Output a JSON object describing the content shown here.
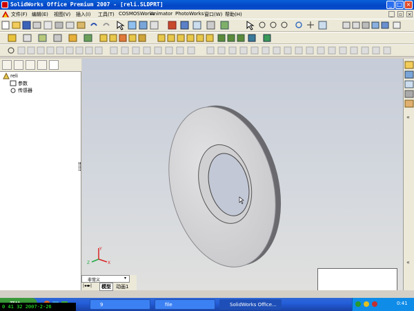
{
  "window": {
    "title": "SolidWorks Office Premium 2007 - [reli.SLDPRT]"
  },
  "menu": {
    "items": [
      "文件(F)",
      "编辑(E)",
      "视图(V)",
      "插入(I)",
      "工具(T)",
      "COSMOSWorks",
      "Animator",
      "PhotoWorks",
      "窗口(W)",
      "帮助(H)"
    ]
  },
  "tree": {
    "root": "reli",
    "items": [
      "参数",
      "传感器"
    ]
  },
  "bottom_tabs": {
    "config": "非常义",
    "model": "模型",
    "animation": "动画1"
  },
  "taskbar": {
    "start": "开始",
    "tasks": [
      "9",
      "file",
      "SolidWorks Office..."
    ],
    "clock": "0:41"
  },
  "clock_overlay": "0 41 32 2007-2-26",
  "axis_labels": {
    "x": "X",
    "y": "Y",
    "z": "Z"
  }
}
